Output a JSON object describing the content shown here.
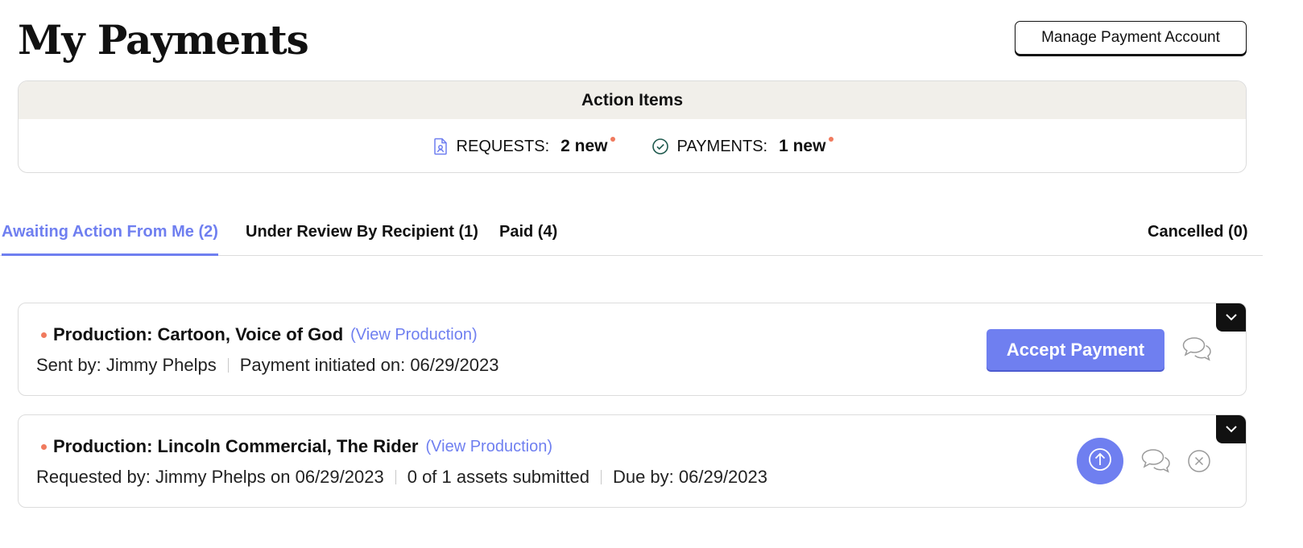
{
  "header": {
    "title": "My Payments",
    "manage_button": "Manage Payment Account"
  },
  "action_items": {
    "heading": "Action Items",
    "requests": {
      "label": "REQUESTS:",
      "count": "2 new",
      "icon": "document-user-icon"
    },
    "payments": {
      "label": "PAYMENTS:",
      "count": "1 new",
      "icon": "check-circle-icon"
    }
  },
  "tabs": [
    {
      "label": "Awaiting Action From Me (2)",
      "active": true
    },
    {
      "label": "Under Review By Recipient (1)",
      "active": false
    },
    {
      "label": "Paid (4)",
      "active": false
    },
    {
      "label": "Cancelled (0)",
      "active": false
    }
  ],
  "cards": [
    {
      "title": "Production: Cartoon, Voice of God",
      "link": "(View Production)",
      "meta": [
        "Sent by: Jimmy Phelps",
        "Payment initiated on: 06/29/2023"
      ],
      "action_label": "Accept Payment"
    },
    {
      "title": "Production: Lincoln Commercial, The Rider",
      "link": "(View Production)",
      "meta": [
        "Requested by: Jimmy Phelps on 06/29/2023",
        "0 of 1 assets submitted",
        "Due by: 06/29/2023"
      ]
    }
  ],
  "colors": {
    "accent": "#6f7ff0",
    "new_dot": "#f07a5e",
    "action_header_bg": "#f1efea"
  }
}
